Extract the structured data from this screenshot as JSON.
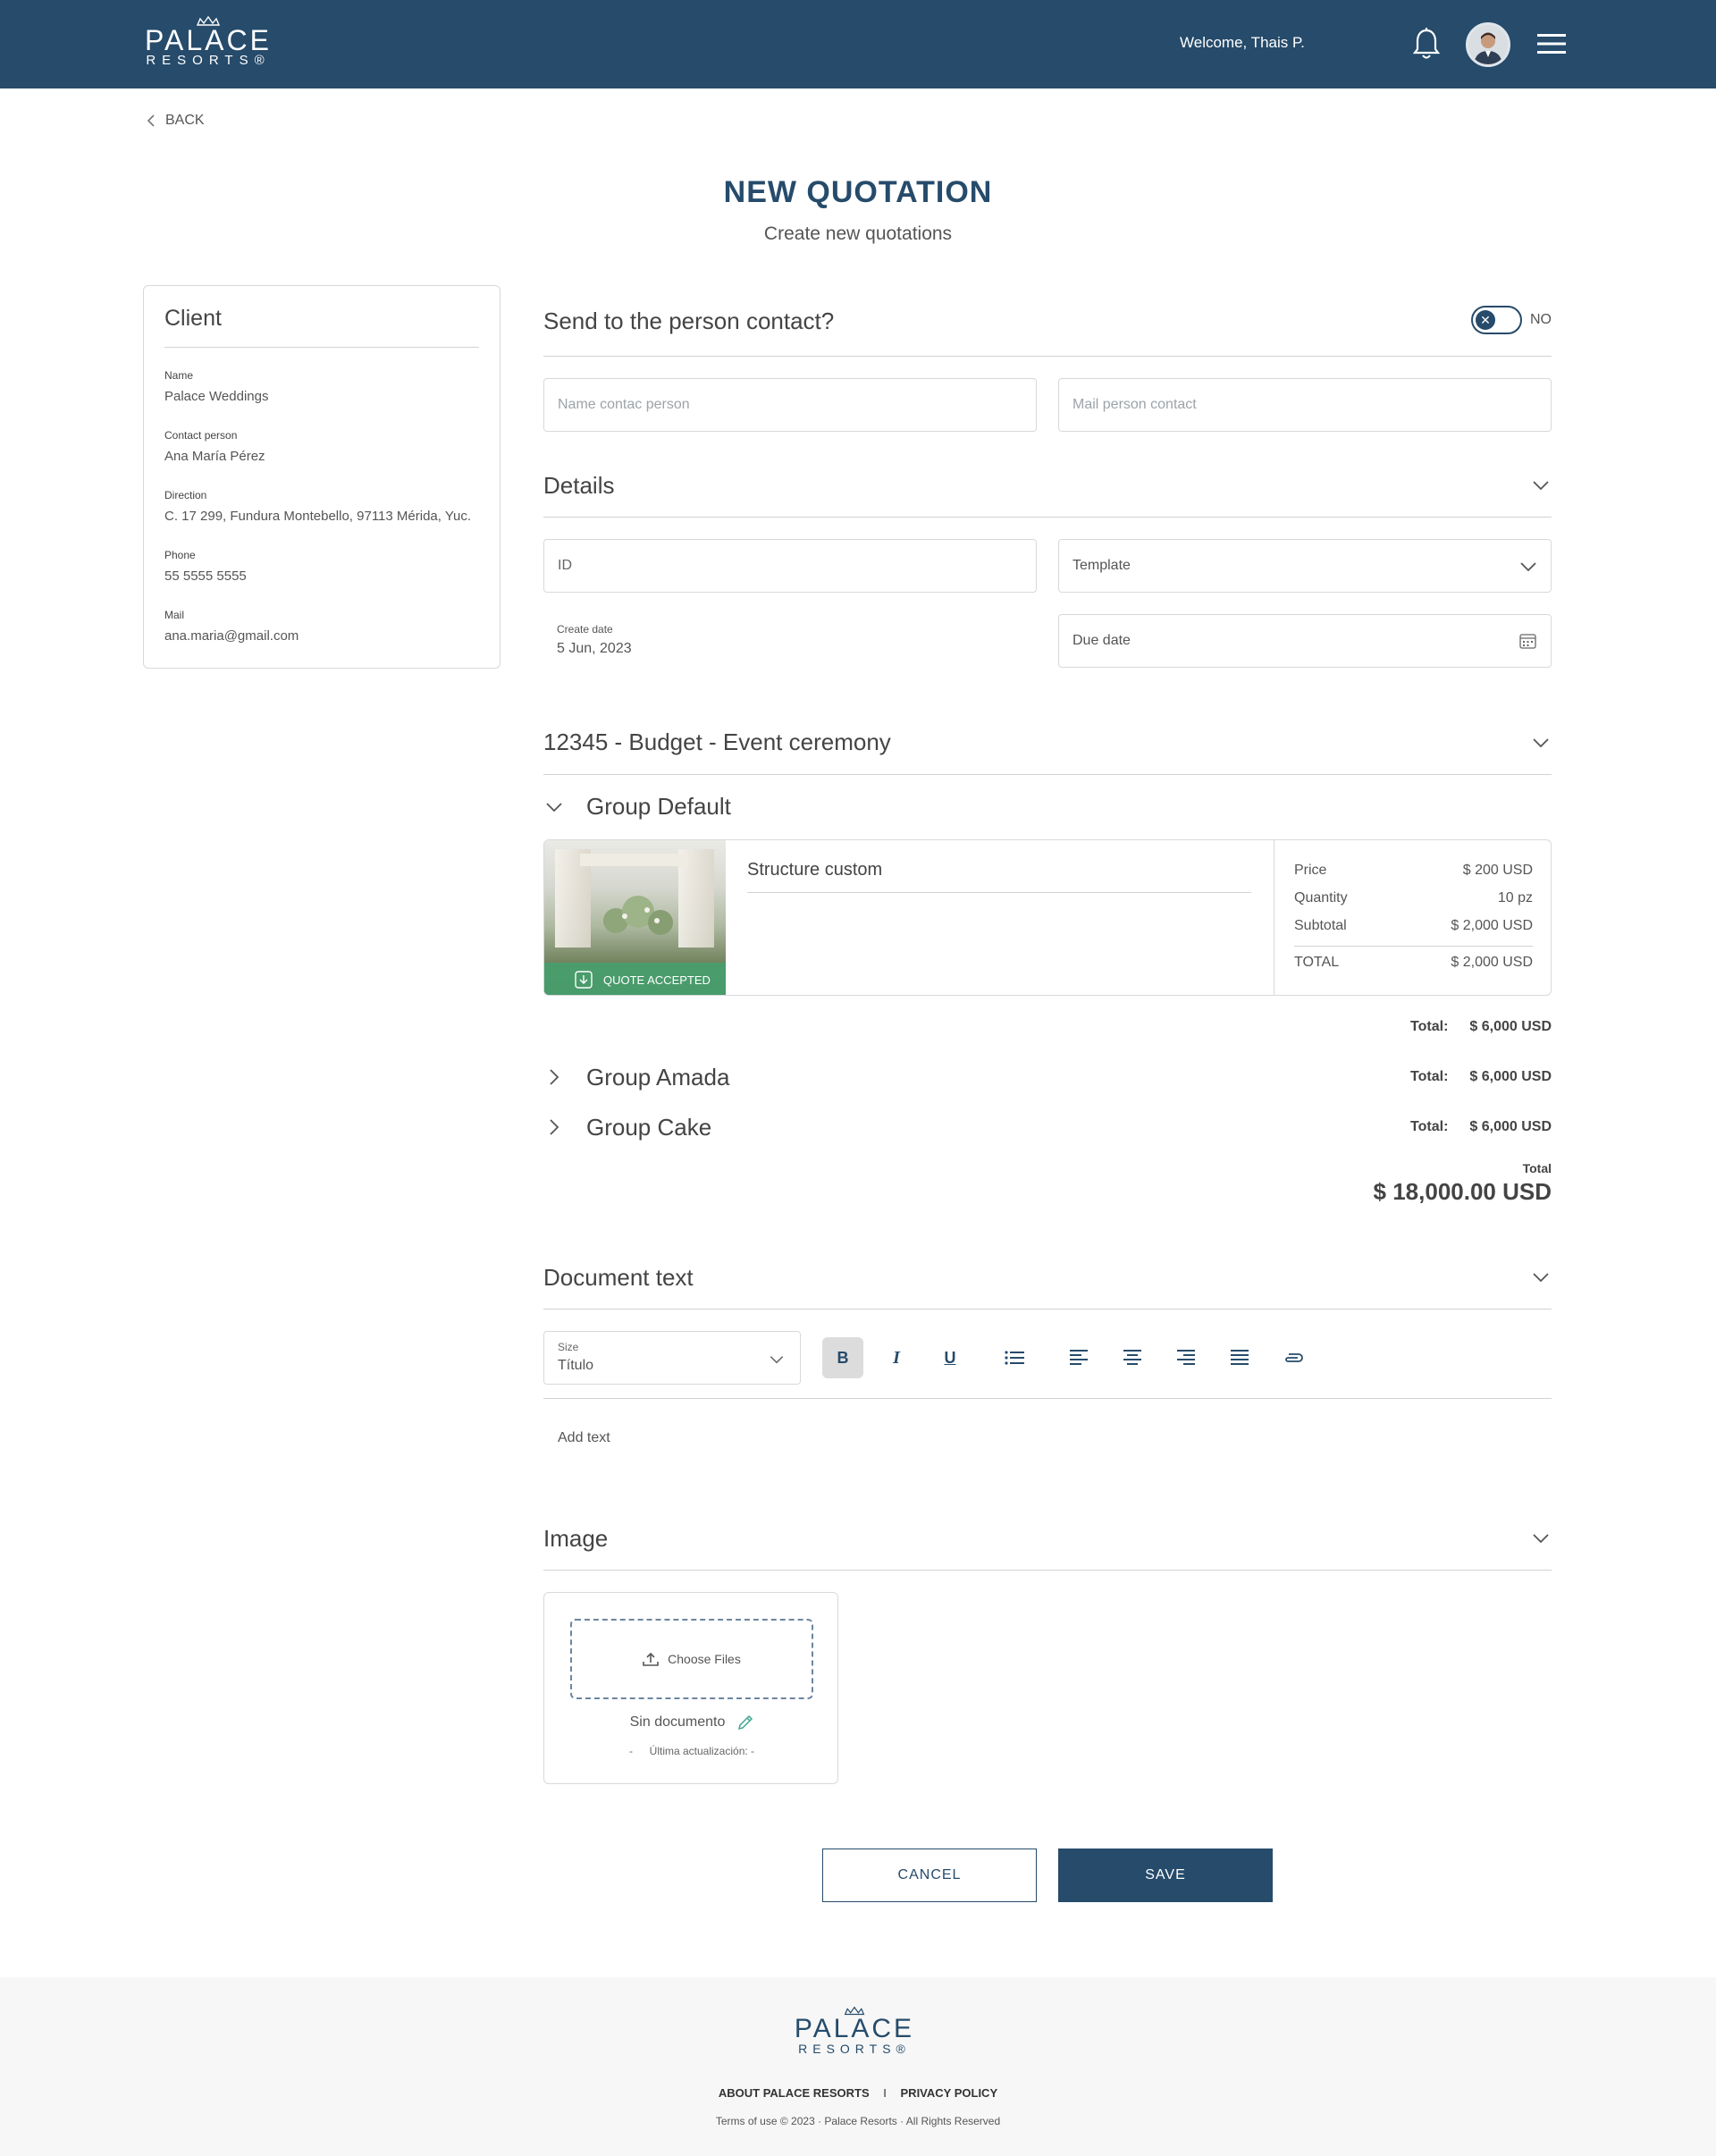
{
  "header": {
    "logo_line1": "PALACE",
    "logo_line2": "RESORTS®",
    "welcome": "Welcome, Thais P."
  },
  "nav": {
    "back_label": "BACK"
  },
  "page": {
    "title": "NEW QUOTATION",
    "subtitle": "Create new quotations"
  },
  "client": {
    "heading": "Client",
    "fields": [
      {
        "label": "Name",
        "value": "Palace Weddings"
      },
      {
        "label": "Contact person",
        "value": "Ana María Pérez"
      },
      {
        "label": "Direction",
        "value": "C. 17 299, Fundura Montebello, 97113 Mérida, Yuc."
      },
      {
        "label": "Phone",
        "value": "55 5555 5555"
      },
      {
        "label": "Mail",
        "value": "ana.maria@gmail.com"
      }
    ]
  },
  "contact": {
    "question": "Send to the person contact?",
    "toggle_state": "NO",
    "name_placeholder": "Name contac person",
    "mail_placeholder": "Mail person contact"
  },
  "details": {
    "heading": "Details",
    "id_placeholder": "ID",
    "template_placeholder": "Template",
    "create_date_label": "Create date",
    "create_date_value": "5 Jun, 2023",
    "due_date_placeholder": "Due date"
  },
  "budget": {
    "heading": "12345 - Budget - Event ceremony",
    "groups": [
      {
        "name": "Group Default",
        "total_label": "Total:",
        "total": "$ 6,000 USD",
        "expanded": true
      },
      {
        "name": "Group Amada",
        "total_label": "Total:",
        "total": "$ 6,000 USD",
        "expanded": false
      },
      {
        "name": "Group Cake",
        "total_label": "Total:",
        "total": "$ 6,000 USD",
        "expanded": false
      }
    ],
    "item": {
      "name": "Structure custom",
      "badge": "QUOTE ACCEPTED",
      "rows": [
        {
          "label": "Price",
          "value": "$ 200 USD"
        },
        {
          "label": "Quantity",
          "value": "10 pz"
        },
        {
          "label": "Subtotal",
          "value": "$ 2,000 USD"
        },
        {
          "label": "TOTAL",
          "value": "$ 2,000 USD"
        }
      ]
    },
    "grand_total_label": "Total",
    "grand_total": "$ 18,000.00 USD"
  },
  "document": {
    "heading": "Document text",
    "size_label": "Size",
    "size_value": "Título",
    "text_placeholder": "Add text"
  },
  "image": {
    "heading": "Image",
    "choose_files": "Choose Files",
    "doc_status": "Sin documento",
    "last_update": "Última actualización: -",
    "last_update_prefix": "-"
  },
  "actions": {
    "cancel": "CANCEL",
    "save": "SAVE"
  },
  "footer": {
    "logo_line1": "PALACE",
    "logo_line2": "RESORTS®",
    "link_about": "ABOUT PALACE RESORTS",
    "separator": "I",
    "link_privacy": "PRIVACY POLICY",
    "copyright": "Terms of use © 2023 · Palace Resorts · All Rights Reserved"
  },
  "colors": {
    "primary": "#264b6b",
    "accepted": "#46a06e",
    "border": "#d6d9dc"
  }
}
